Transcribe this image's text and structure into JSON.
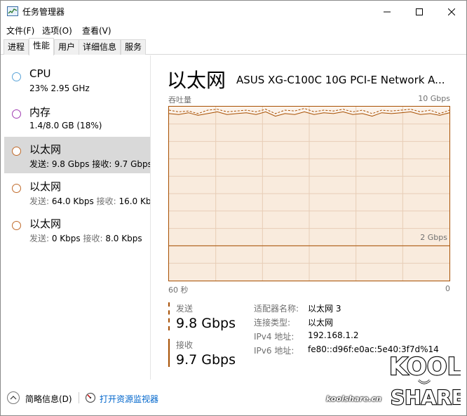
{
  "window": {
    "title": "任务管理器",
    "icon": "task-manager-icon",
    "controls": [
      "minimize",
      "maximize",
      "close"
    ]
  },
  "menu": [
    "文件(F)",
    "选项(O)",
    "查看(V)"
  ],
  "tabs": [
    {
      "label": "进程",
      "active": false
    },
    {
      "label": "性能",
      "active": true
    },
    {
      "label": "用户",
      "active": false
    },
    {
      "label": "详细信息",
      "active": false
    },
    {
      "label": "服务",
      "active": false
    }
  ],
  "resources": [
    {
      "name": "CPU",
      "detail": "23%  2.95 GHz",
      "color": "#5aa4d8"
    },
    {
      "name": "内存",
      "detail": "1.4/8.0 GB (18%)",
      "color": "#a03cb2"
    },
    {
      "name": "以太网",
      "detail_prefix": "发送: ",
      "detail_send": "9.8 Gbps",
      "detail_mid": " 接收: ",
      "detail_recv": "9.7 Gbps",
      "color": "#c06a2a",
      "selected": true
    },
    {
      "name": "以太网",
      "detail_prefix": "发送: ",
      "detail_send": "64.0 Kbps",
      "detail_mid": " 接收: ",
      "detail_recv": "16.0 Kb",
      "color": "#c06a2a"
    },
    {
      "name": "以太网",
      "detail_prefix": "发送: ",
      "detail_send": "0 Kbps",
      "detail_mid": " 接收: ",
      "detail_recv": "8.0 Kbps",
      "color": "#c06a2a"
    }
  ],
  "detail": {
    "title": "以太网",
    "model": "ASUS XG-C100C 10G PCI-E Network A...",
    "chart_label": "吞吐量",
    "chart_max": "10 Gbps",
    "chart_mid": "2 Gbps",
    "time_left": "60 秒",
    "time_right": "0",
    "send_label": "发送",
    "send_value": "9.8 Gbps",
    "recv_label": "接收",
    "recv_value": "9.7 Gbps",
    "properties": [
      {
        "key": "适配器名称:",
        "value": "以太网 3"
      },
      {
        "key": "连接类型:",
        "value": "以太网"
      },
      {
        "key": "IPv4 地址:",
        "value": "192.168.1.2"
      },
      {
        "key": "IPv6 地址:",
        "value": "fe80::d96f:e0ac:5e40:3f7d%14"
      }
    ]
  },
  "chart_data": {
    "type": "line",
    "title": "吞吐量",
    "ylim": [
      0,
      10
    ],
    "ylabel": "Gbps",
    "x_range": [
      "60 秒",
      "0"
    ],
    "series": [
      {
        "name": "发送",
        "values": [
          9.8,
          9.7,
          9.75,
          9.6,
          9.8,
          9.85,
          9.7,
          9.75,
          9.8,
          9.7,
          9.85,
          9.6,
          9.8,
          9.75,
          9.9,
          9.7,
          9.8,
          9.75,
          9.85,
          9.7,
          9.8,
          9.6,
          9.8,
          9.75,
          9.8,
          9.85,
          9.7,
          9.8,
          9.6,
          9.8
        ],
        "style": "dashed"
      },
      {
        "name": "接收",
        "values": [
          9.6,
          9.55,
          9.65,
          9.5,
          9.6,
          9.7,
          9.55,
          9.6,
          9.65,
          9.55,
          9.7,
          9.45,
          9.6,
          9.55,
          9.7,
          9.55,
          9.65,
          9.6,
          9.7,
          9.55,
          9.6,
          9.45,
          9.65,
          9.6,
          9.65,
          9.7,
          9.55,
          9.6,
          9.5,
          9.65
        ],
        "style": "solid"
      }
    ],
    "grid": true
  },
  "footer": {
    "fewer_details": "简略信息(D)",
    "open_monitor": "打开资源监视器"
  },
  "watermark": {
    "site": "koolshare.cn",
    "logo_text": [
      "KOOL",
      "SHARE"
    ]
  }
}
